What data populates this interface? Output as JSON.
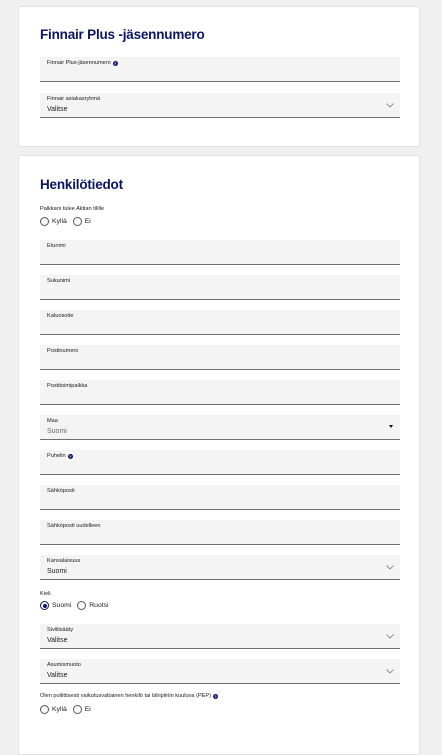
{
  "membership": {
    "title": "Finnair Plus -jäsennumero",
    "member_number_label": "Finnair Plus-jäsennumero",
    "customer_group_label": "Finnair asiakasryhmä",
    "customer_group_value": "Valitse"
  },
  "personal": {
    "title": "Henkilötiedot",
    "invoice_question": "Palkkani tulee Aktian tilille",
    "yes_label": "Kyllä",
    "no_label": "Ei",
    "first_name_label": "Etunimi",
    "last_name_label": "Sukunimi",
    "street_label": "Katuosoite",
    "postal_code_label": "Postinumero",
    "city_label": "Postitoimipaikka",
    "country_label": "Maa",
    "country_value": "Suomi",
    "phone_label": "Puhelin",
    "email_label": "Sähköposti",
    "email_repeat_label": "Sähköposti uudelleen",
    "nationality_label": "Kansalaisuus",
    "nationality_value": "Suomi",
    "language_label": "Kieli",
    "language_options": [
      "Suomi",
      "Ruotsi"
    ],
    "language_selected": "Suomi",
    "marital_status_label": "Siviilisääty",
    "marital_status_value": "Valitse",
    "housing_label": "Asumismuoto",
    "housing_value": "Valitse",
    "pep_question": "Olen poliittisesti vaikutusvaltainen henkilö tai lähipiiriin kuuluva (PEP)",
    "pep_yes": "Kyllä",
    "pep_no": "Ei"
  },
  "colors": {
    "brand_navy": "#0b1560",
    "field_bg": "#f4f4f4",
    "page_bg": "#f0f0f0"
  },
  "icons": {
    "help": "help-circle-icon",
    "dropdown": "chevron-down-icon",
    "country_dropdown": "caret-down-icon"
  }
}
